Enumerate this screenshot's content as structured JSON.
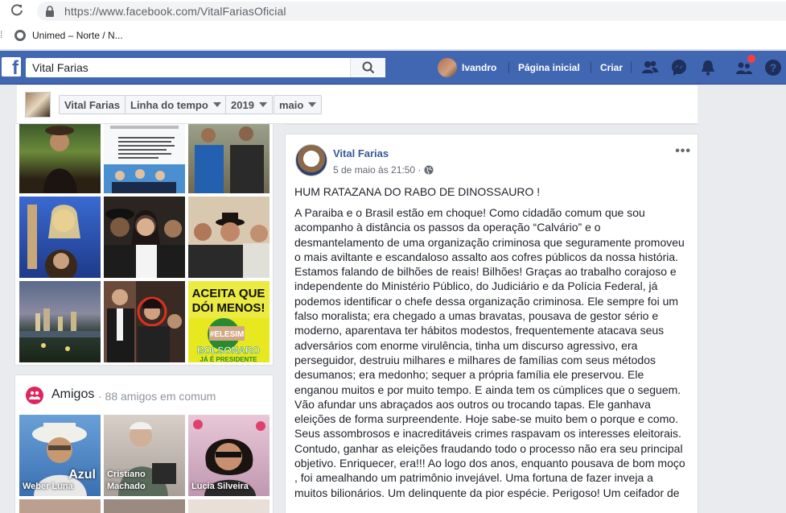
{
  "browser": {
    "url": "https://www.facebook.com/VitalFariasOficial",
    "bookmark_label": "Unimed – Norte / N..."
  },
  "header": {
    "search_value": "Vital Farias",
    "user_name": "Ivandro",
    "home_label": "Página inicial",
    "create_label": "Criar"
  },
  "timeline_bar": {
    "profile_name": "Vital Farias",
    "section": "Linha do tempo",
    "year": "2019",
    "month": "maio"
  },
  "photos": {
    "tiles": [
      {
        "icon": "photo-guitar-man"
      },
      {
        "icon": "photo-text-post"
      },
      {
        "icon": "photo-blue-shirt-men"
      },
      {
        "icon": "photo-guitar-woman"
      },
      {
        "icon": "photo-three-people"
      },
      {
        "icon": "photo-group-hats"
      },
      {
        "icon": "photo-city-night"
      },
      {
        "icon": "photo-circled-person"
      },
      {
        "icon": "photo-protest-sign"
      }
    ],
    "sign_lines": [
      "ACEITA QUE",
      "DÓI MENOS!",
      "#ELESIM",
      "BOLSONARO",
      "JÁ É PRESIDENTE"
    ]
  },
  "friends": {
    "title": "Amigos",
    "count_text": "· 88 amigos em comum",
    "tiles": [
      {
        "name": "Weber Luna",
        "overlay": "Azul"
      },
      {
        "name": "Cristiano Machado",
        "overlay": ""
      },
      {
        "name": "Lucia Silveira",
        "overlay": ""
      }
    ]
  },
  "post": {
    "author": "Vital Farias",
    "time": "5 de maio às 21:50 ·",
    "headline": "HUM RATAZANA DO RABO DE DINOSSAURO !",
    "body_lines": [
      "A Paraiba e o Brasil estão em choque! Como cidadão comum que sou",
      "acompanho à distância os passos da operação “Calvário” e o",
      "desmantelamento de uma organização criminosa que seguramente promoveu",
      "o mais aviltante e escandaloso assalto aos cofres públicos da nossa história.",
      "Estamos falando de bilhões de reais! Bilhões! Graças ao trabalho corajoso e",
      "independente do Ministério Público, do Judiciário e da Polícia Federal, já",
      "podemos identificar o chefe dessa organização criminosa. Ele sempre foi um",
      "falso moralista; era chegado a umas bravatas, pousava de gestor sério e",
      "moderno, aparentava ter hábitos modestos, frequentemente atacava seus",
      "adversários com enorme virulência, tinha um discurso agressivo, era",
      "perseguidor, destruiu milhares e milhares de famílias com seus métodos",
      "desumanos; era medonho; sequer a própria família ele preservou. Ele",
      "enganou muitos e por muito tempo. E ainda tem os cúmplices que o seguem.",
      "Vão afundar uns abraçados aos outros ou trocando tapas. Ele ganhava",
      "eleições de forma surpreendente. Hoje sabe-se muito bem o porque e como.",
      "Seus assombrosos e inacreditáveis crimes raspavam os interesses eleitorais.",
      "Contudo, ganhar as eleições fraudando todo o processo não era seu principal",
      "objetivo. Enriquecer, era!!! Ao logo dos anos, enquanto pousava de bom moço",
      ", foi amealhando um patrimônio invejável. Uma fortuna de fazer inveja a",
      "muitos bilionários. Um delinquente da pior espécie. Perigoso! Um ceifador de"
    ]
  },
  "colors": {
    "fb_blue": "#4267b2",
    "link_blue": "#365899",
    "friends_pink": "#e0245e",
    "notification_red": "#fa3e3e"
  }
}
